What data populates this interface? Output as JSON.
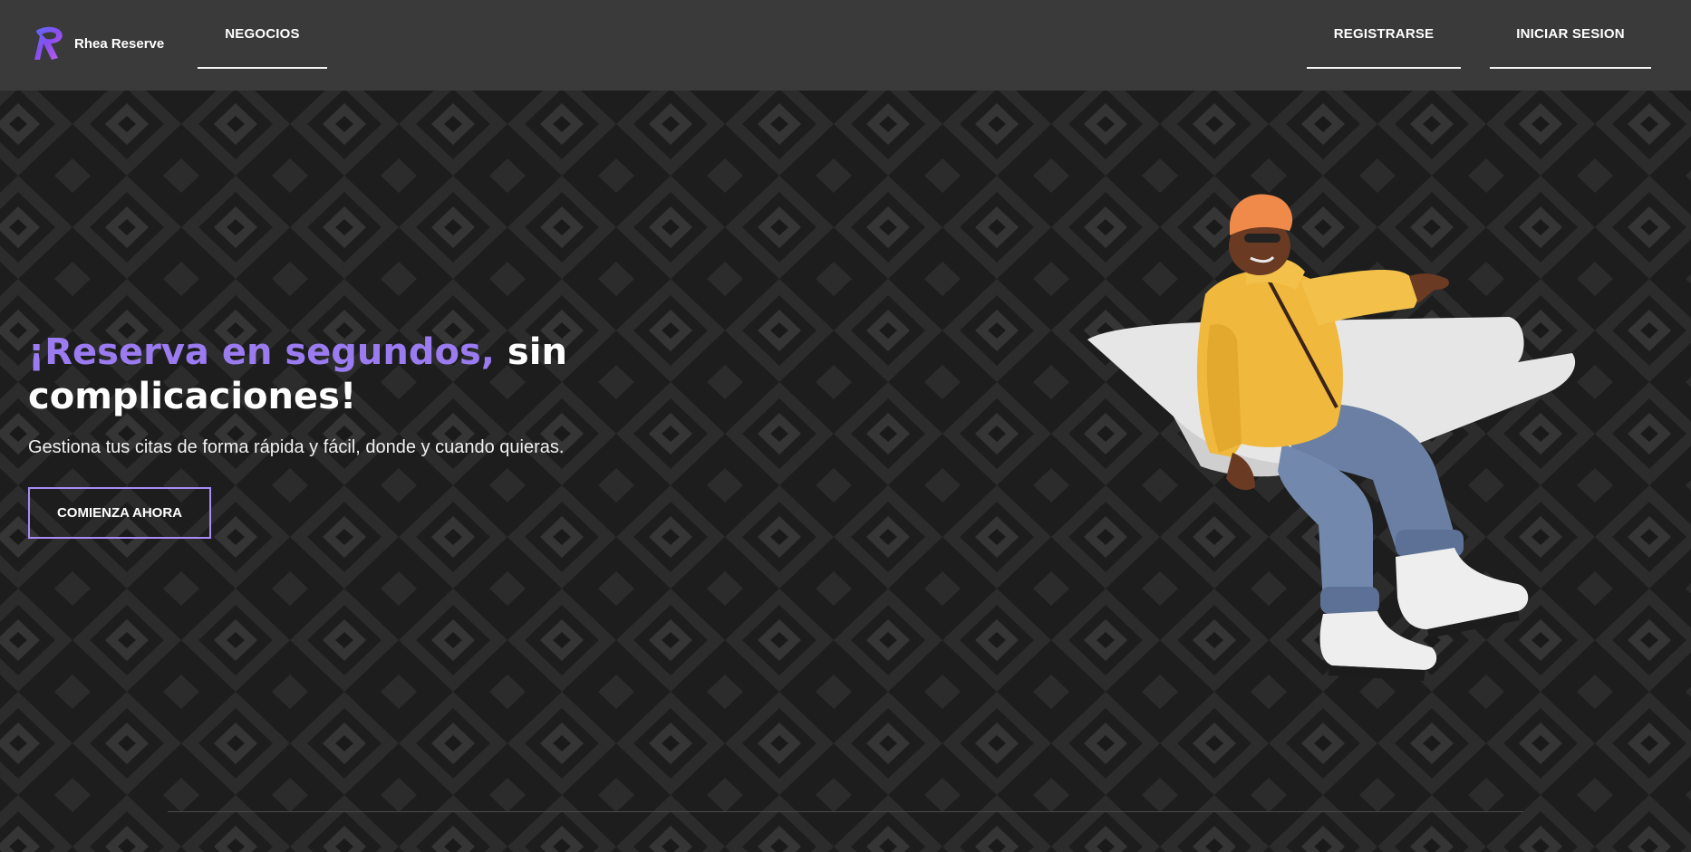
{
  "brand": {
    "name": "Rhea Reserve",
    "icon": "rhea-logo-icon"
  },
  "nav": {
    "negocios": "NEGOCIOS",
    "registrarse": "REGISTRARSE",
    "iniciar_sesion": "INICIAR SESION"
  },
  "hero": {
    "title_accent": "¡Reserva en segundos,",
    "title_rest": " sin complicaciones!",
    "subtitle": "Gestiona tus citas de forma rápida y fácil, donde y cuando quieras.",
    "cta": "COMIENZA AHORA",
    "illustration": "person-on-paper-plane-illustration"
  },
  "colors": {
    "accent": "#9b7bf0",
    "navbar": "#3a3a3a",
    "background": "#1f1f1f",
    "cta_border": "#a98cf6"
  }
}
